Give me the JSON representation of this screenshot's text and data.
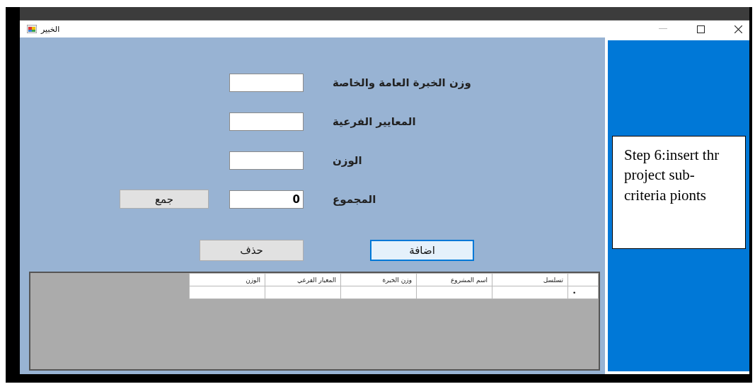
{
  "window": {
    "title": "الخبير"
  },
  "fields": [
    {
      "label": "وزن الخبرة العامة والخاصة"
    },
    {
      "label": "المعايير الفرعية"
    },
    {
      "label": "الوزن"
    },
    {
      "label": "المجموع",
      "value": "0"
    }
  ],
  "sum_button": "جمع",
  "actions": [
    {
      "label": "اضافة",
      "focused": true
    },
    {
      "label": "حذف",
      "focused": false
    }
  ],
  "table": {
    "columns": [
      "تسلسل",
      "اسم المشروع",
      "وزن الخبرة",
      "المعيار الفرعي",
      "الوزن"
    ],
    "new_row_marker": "•"
  },
  "annotation": "Step 6:insert thr project sub-criteria pionts"
}
